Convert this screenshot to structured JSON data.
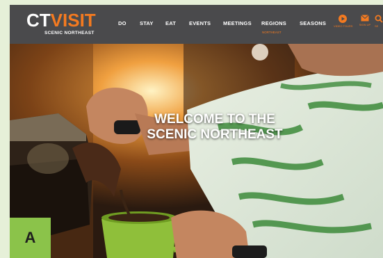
{
  "logo": {
    "ct": "CT",
    "visit": "VISIT",
    "sub": "SCENIC NORTHEAST"
  },
  "nav": {
    "items": [
      "DO",
      "STAY",
      "EAT",
      "EVENTS",
      "MEETINGS",
      "REGIONS",
      "SEASONS"
    ],
    "regions_sub": "NORTHEAST"
  },
  "utility": [
    {
      "icon": "play-icon",
      "label": "VIDEO TOURS"
    },
    {
      "icon": "mail-icon",
      "label": "SIGN UP"
    },
    {
      "icon": "search-icon",
      "label": "SE"
    }
  ],
  "hero": {
    "line1": "WELCOME TO THE",
    "line2": "SCENIC NORTHEAST"
  },
  "badge": {
    "letter": "A"
  },
  "colors": {
    "accent": "#f47a20",
    "navbar": "#4a4a4c",
    "badge": "#8bc34a",
    "page_bg": "#e6f0d8"
  }
}
